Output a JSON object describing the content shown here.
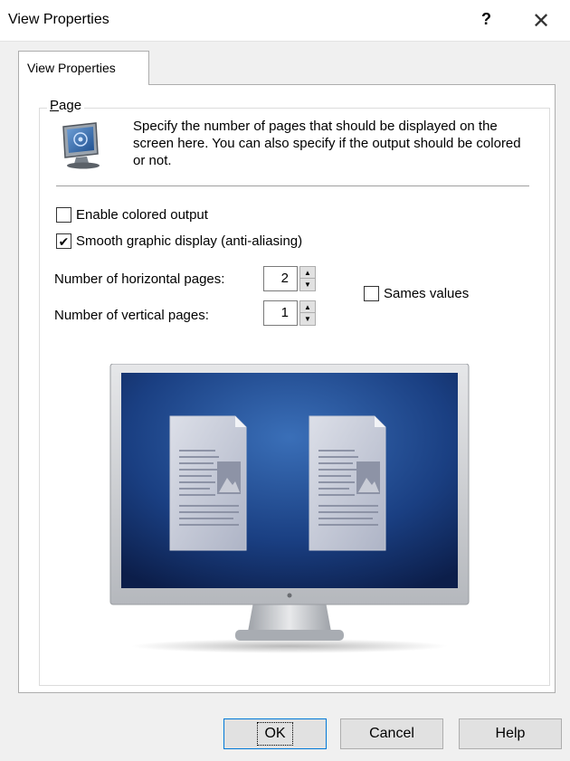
{
  "window": {
    "title": "View Properties",
    "help_label": "?",
    "close_label": "✕"
  },
  "tab": {
    "label": "View Properties"
  },
  "group": {
    "label_accel": "P",
    "label_rest": "age",
    "description": "Specify the number of pages that should be displayed on the screen here. You can also specify if the output should be colored or not."
  },
  "options": {
    "colored_output": {
      "label": "Enable colored output",
      "checked": false
    },
    "smooth_display": {
      "label": "Smooth graphic display (anti-aliasing)",
      "checked": true,
      "check_glyph": "✔"
    },
    "same_values": {
      "label": "Sames values",
      "checked": false
    }
  },
  "pages": {
    "horizontal_label": "Number of horizontal pages:",
    "horizontal_value": "2",
    "vertical_label": "Number of vertical pages:",
    "vertical_value": "1",
    "up_glyph": "▲",
    "down_glyph": "▼"
  },
  "buttons": {
    "ok": "OK",
    "cancel": "Cancel",
    "help": "Help"
  },
  "colors": {
    "accent": "#0078d7",
    "screen_dark": "#0c1e4a",
    "screen_light": "#3a6fb8"
  }
}
